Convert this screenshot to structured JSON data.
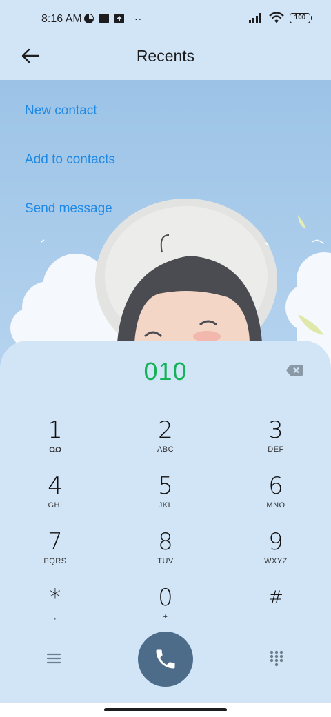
{
  "status_bar": {
    "time": "8:16 AM",
    "battery": "100",
    "dots": "··",
    "icons": [
      "game-icon",
      "square-icon",
      "upload-icon",
      "signal-icon",
      "wifi-icon",
      "battery-icon"
    ]
  },
  "header": {
    "title": "Recents",
    "back_icon": "arrow-left-icon"
  },
  "actions": {
    "new_contact": "New contact",
    "add_to_contacts": "Add to contacts",
    "send_message": "Send message"
  },
  "dialer": {
    "number": "010",
    "backspace_icon": "backspace-icon",
    "keys": [
      {
        "digit": "1",
        "letters": ""
      },
      {
        "digit": "2",
        "letters": "ABC"
      },
      {
        "digit": "3",
        "letters": "DEF"
      },
      {
        "digit": "4",
        "letters": "GHI"
      },
      {
        "digit": "5",
        "letters": "JKL"
      },
      {
        "digit": "6",
        "letters": "MNO"
      },
      {
        "digit": "7",
        "letters": "PQRS"
      },
      {
        "digit": "8",
        "letters": "TUV"
      },
      {
        "digit": "9",
        "letters": "WXYZ"
      },
      {
        "digit": "*",
        "letters": ","
      },
      {
        "digit": "0",
        "letters": "+"
      },
      {
        "digit": "#",
        "letters": ""
      }
    ],
    "key1_icon": "voicemail-icon",
    "menu_icon": "menu-icon",
    "call_icon": "phone-icon",
    "dialpad_icon": "dialpad-icon"
  },
  "colors": {
    "background": "#d2e5f7",
    "accent_link": "#1e88e5",
    "number": "#16b25a",
    "call_button": "#4d6c8a"
  }
}
